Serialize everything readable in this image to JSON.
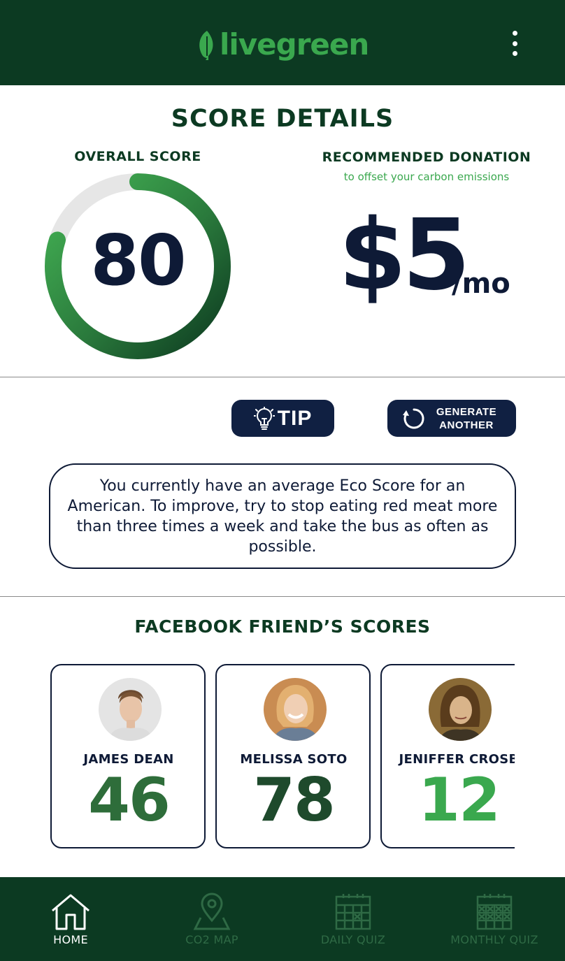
{
  "header": {
    "logo_text": "livegreen",
    "menu_icon": "kebab-menu-icon"
  },
  "score_section": {
    "title": "SCORE DETAILS",
    "overall_label": "OVERALL SCORE",
    "overall_score": "80",
    "overall_score_value": 80,
    "donation_label": "RECOMMENDED DONATION",
    "donation_subtitle": "to offset your carbon emissions",
    "donation_amount": "$5",
    "donation_unit": "/mo"
  },
  "tip_section": {
    "tip_button": "TIP",
    "generate_button": "GENERATE ANOTHER",
    "tip_text": "You currently have an average Eco Score for an American. To improve, try to stop eating red meat more than three times a week and take the bus as often as possible."
  },
  "friends_section": {
    "title": "FACEBOOK FRIEND’S SCORES",
    "friends": [
      {
        "name": "JAMES DEAN",
        "score": "46",
        "score_color": "#2e6d3a"
      },
      {
        "name": "MELISSA SOTO",
        "score": "78",
        "score_color": "#1e4a2c"
      },
      {
        "name": "JENIFFER CROSB",
        "score": "12",
        "score_color": "#3aa84e"
      }
    ]
  },
  "bottom_nav": {
    "items": [
      {
        "label": "HOME",
        "icon": "home-icon",
        "active": true
      },
      {
        "label": "CO2 MAP",
        "icon": "map-pin-icon",
        "active": false
      },
      {
        "label": "DAILY QUIZ",
        "icon": "calendar-icon",
        "active": false
      },
      {
        "label": "MONTHLY QUIZ",
        "icon": "calendar-grid-icon",
        "active": false
      }
    ]
  },
  "colors": {
    "brand_dark_green": "#0c3a22",
    "brand_green": "#3aa84e",
    "navy": "#0e1a36",
    "gauge_track": "#e6e6e6"
  }
}
